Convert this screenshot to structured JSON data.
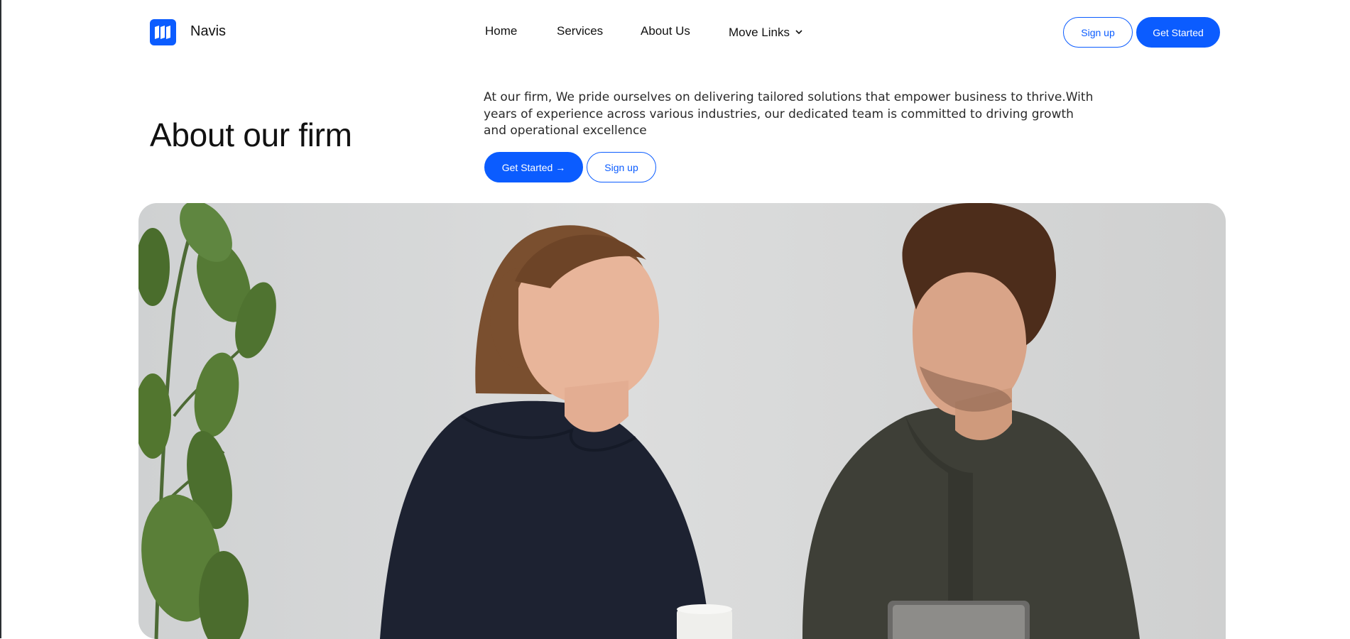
{
  "brand": {
    "name": "Navis",
    "accent": "#0b5cff"
  },
  "nav": {
    "links": [
      {
        "label": "Home"
      },
      {
        "label": "Services"
      },
      {
        "label": "About Us"
      },
      {
        "label": "Move Links"
      }
    ],
    "signup_label": "Sign up",
    "get_started_label": "Get Started"
  },
  "hero": {
    "title": "About our firm",
    "description": "At our firm, We pride ourselves on delivering tailored solutions that empower business to thrive.With years of experience across various industries, our dedicated team is committed to driving growth and operational excellence",
    "get_started_label": "Get Started →",
    "signup_label": "Sign up"
  },
  "image": {
    "subject": "two-colleagues-talking-photo"
  }
}
